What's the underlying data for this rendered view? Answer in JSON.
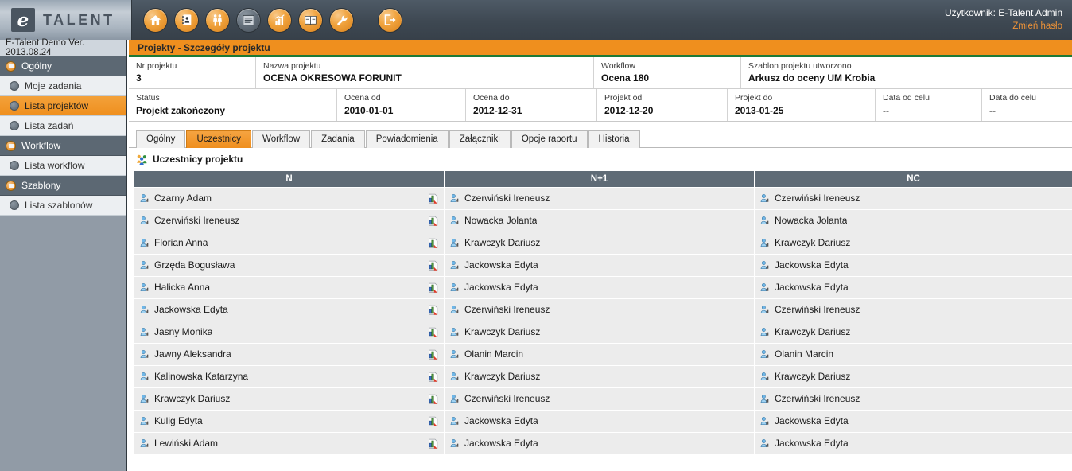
{
  "brand": {
    "logo_letter": "e",
    "logo_text": "TALENT"
  },
  "toolbar": {
    "icons": [
      {
        "name": "home-icon",
        "label": "Home",
        "active": false
      },
      {
        "name": "address-book-icon",
        "label": "Kontakty",
        "active": false
      },
      {
        "name": "people-icon",
        "label": "Pracownicy",
        "active": false
      },
      {
        "name": "list-icon",
        "label": "Projekty",
        "active": true
      },
      {
        "name": "bar-chart-icon",
        "label": "Raporty",
        "active": false
      },
      {
        "name": "book-icon",
        "label": "Słownik",
        "active": false
      },
      {
        "name": "wrench-icon",
        "label": "Narzędzia",
        "active": false
      },
      {
        "name": "logout-icon",
        "label": "Wyloguj",
        "active": false
      }
    ]
  },
  "user": {
    "label": "Użytkownik: E-Talent Admin",
    "change_password_link": "Zmień hasło"
  },
  "sidebar": {
    "version": "E-Talent Demo Ver. 2013.08.24",
    "groups": [
      {
        "label": "Ogólny",
        "items": [
          {
            "label": "Moje zadania",
            "selected": false
          },
          {
            "label": "Lista projektów",
            "selected": true
          },
          {
            "label": "Lista zadań",
            "selected": false
          }
        ]
      },
      {
        "label": "Workflow",
        "items": [
          {
            "label": "Lista workflow",
            "selected": false
          }
        ]
      },
      {
        "label": "Szablony",
        "items": [
          {
            "label": "Lista szablonów",
            "selected": false
          }
        ]
      }
    ]
  },
  "page": {
    "title": "Projekty - Szczegóły projektu",
    "accent_orange": "#ef8f1e",
    "accent_green": "#1d7a36"
  },
  "project_info": {
    "row1": [
      {
        "label": "Nr projektu",
        "value": "3"
      },
      {
        "label": "Nazwa projektu",
        "value": "OCENA OKRESOWA FORUNIT"
      },
      {
        "label": "Workflow",
        "value": "Ocena 180"
      },
      {
        "label": "Szablon projektu utworzono",
        "value": "Arkusz do oceny UM Krobia"
      }
    ],
    "row2": [
      {
        "label": "Status",
        "value": "Projekt zakończony"
      },
      {
        "label": "Ocena od",
        "value": "2010-01-01"
      },
      {
        "label": "Ocena do",
        "value": "2012-12-31"
      },
      {
        "label": "Projekt od",
        "value": "2012-12-20"
      },
      {
        "label": "Projekt do",
        "value": "2013-01-25"
      },
      {
        "label": "Data od celu",
        "value": "--"
      },
      {
        "label": "Data do celu",
        "value": "--"
      }
    ]
  },
  "tabs": [
    {
      "label": "Ogólny",
      "active": false
    },
    {
      "label": "Uczestnicy",
      "active": true
    },
    {
      "label": "Workflow",
      "active": false
    },
    {
      "label": "Zadania",
      "active": false
    },
    {
      "label": "Powiadomienia",
      "active": false
    },
    {
      "label": "Załączniki",
      "active": false
    },
    {
      "label": "Opcje raportu",
      "active": false
    },
    {
      "label": "Historia",
      "active": false
    }
  ],
  "section": {
    "heading": "Uczestnicy projektu"
  },
  "participants_table": {
    "columns": [
      "N",
      "N+1",
      "NC"
    ],
    "rows": [
      {
        "n": "Czarny Adam",
        "n1": "Czerwiński Ireneusz",
        "nc": "Czerwiński Ireneusz"
      },
      {
        "n": "Czerwiński Ireneusz",
        "n1": "Nowacka Jolanta",
        "nc": "Nowacka Jolanta"
      },
      {
        "n": "Florian Anna",
        "n1": "Krawczyk Dariusz",
        "nc": "Krawczyk Dariusz"
      },
      {
        "n": "Grzęda Bogusława",
        "n1": "Jackowska Edyta",
        "nc": "Jackowska Edyta"
      },
      {
        "n": "Halicka Anna",
        "n1": "Jackowska Edyta",
        "nc": "Jackowska Edyta"
      },
      {
        "n": "Jackowska Edyta",
        "n1": "Czerwiński Ireneusz",
        "nc": "Czerwiński Ireneusz"
      },
      {
        "n": "Jasny Monika",
        "n1": "Krawczyk Dariusz",
        "nc": "Krawczyk Dariusz"
      },
      {
        "n": "Jawny Aleksandra",
        "n1": "Olanin Marcin",
        "nc": "Olanin Marcin"
      },
      {
        "n": "Kalinowska Katarzyna",
        "n1": "Krawczyk Dariusz",
        "nc": "Krawczyk Dariusz"
      },
      {
        "n": "Krawczyk Dariusz",
        "n1": "Czerwiński Ireneusz",
        "nc": "Czerwiński Ireneusz"
      },
      {
        "n": "Kulig Edyta",
        "n1": "Jackowska Edyta",
        "nc": "Jackowska Edyta"
      },
      {
        "n": "Lewiński Adam",
        "n1": "Jackowska Edyta",
        "nc": "Jackowska Edyta"
      }
    ],
    "row_icon": "user-icon",
    "action_icon": "report-chart-icon"
  }
}
